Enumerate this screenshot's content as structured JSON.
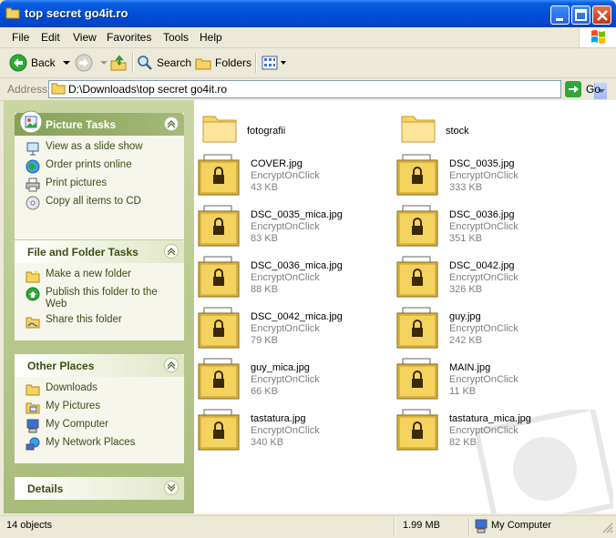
{
  "window": {
    "title": "top secret go4it.ro"
  },
  "menu": [
    "File",
    "Edit",
    "View",
    "Favorites",
    "Tools",
    "Help"
  ],
  "toolbar": {
    "back": "Back",
    "search": "Search",
    "folders": "Folders"
  },
  "address": {
    "label": "Address",
    "path": "D:\\Downloads\\top secret go4it.ro",
    "go": "Go"
  },
  "panels": {
    "picture_tasks": {
      "title": "Picture Tasks",
      "items": [
        "View as a slide show",
        "Order prints online",
        "Print pictures",
        "Copy all items to CD"
      ]
    },
    "file_folder_tasks": {
      "title": "File and Folder Tasks",
      "items": [
        "Make a new folder",
        "Publish this folder to the Web",
        "Share this folder"
      ]
    },
    "other_places": {
      "title": "Other Places",
      "items": [
        "Downloads",
        "My Pictures",
        "My Computer",
        "My Network Places"
      ]
    },
    "details": {
      "title": "Details"
    }
  },
  "folders": [
    {
      "name": "fotografii"
    },
    {
      "name": "stock"
    }
  ],
  "files": [
    {
      "name": "COVER.jpg",
      "type": "EncryptOnClick",
      "size": "43 KB"
    },
    {
      "name": "DSC_0035.jpg",
      "type": "EncryptOnClick",
      "size": "333 KB"
    },
    {
      "name": "DSC_0035_mica.jpg",
      "type": "EncryptOnClick",
      "size": "83 KB"
    },
    {
      "name": "DSC_0036.jpg",
      "type": "EncryptOnClick",
      "size": "351 KB"
    },
    {
      "name": "DSC_0036_mica.jpg",
      "type": "EncryptOnClick",
      "size": "88 KB"
    },
    {
      "name": "DSC_0042.jpg",
      "type": "EncryptOnClick",
      "size": "326 KB"
    },
    {
      "name": "DSC_0042_mica.jpg",
      "type": "EncryptOnClick",
      "size": "79 KB"
    },
    {
      "name": "guy.jpg",
      "type": "EncryptOnClick",
      "size": "242 KB"
    },
    {
      "name": "guy_mica.jpg",
      "type": "EncryptOnClick",
      "size": "66 KB"
    },
    {
      "name": "MAIN.jpg",
      "type": "EncryptOnClick",
      "size": "11 KB"
    },
    {
      "name": "tastatura.jpg",
      "type": "EncryptOnClick",
      "size": "340 KB"
    },
    {
      "name": "tastatura_mica.jpg",
      "type": "EncryptOnClick",
      "size": "82 KB"
    }
  ],
  "status": {
    "objects": "14 objects",
    "size": "1.99 MB",
    "location": "My Computer"
  },
  "colors": {
    "titlebar": "#0250d8",
    "taskpane": "#a8bb7b",
    "panel_text": "#3d4d14",
    "lock_file": "#e8c44a"
  }
}
